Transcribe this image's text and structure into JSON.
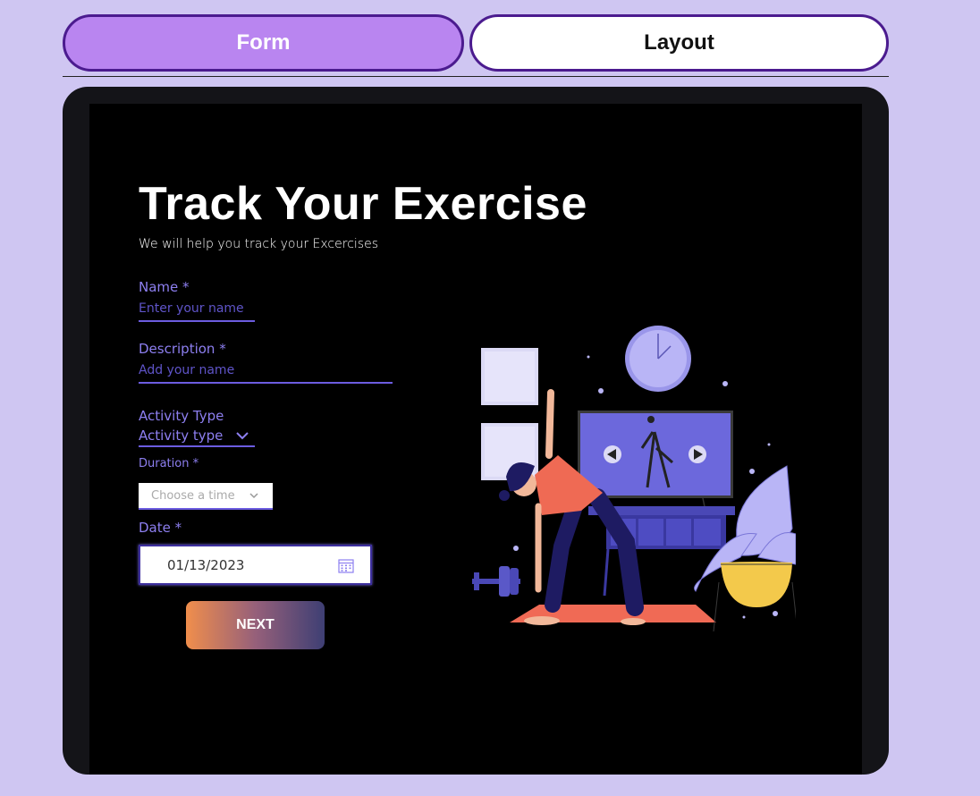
{
  "tabs": {
    "form_label": "Form",
    "layout_label": "Layout"
  },
  "form": {
    "title": "Track Your Exercise",
    "subtitle": "We will help you track your Excercises",
    "name": {
      "label": "Name *",
      "placeholder": "Enter your name",
      "value": ""
    },
    "description": {
      "label": "Description *",
      "placeholder": "Add your name",
      "value": ""
    },
    "activity": {
      "label": "Activity Type",
      "selected": "Activity type"
    },
    "duration": {
      "label": "Duration *",
      "selected": "Choose a time"
    },
    "date": {
      "label": "Date *",
      "value": "01/13/2023"
    },
    "next_label": "NEXT"
  },
  "colors": {
    "background": "#cfc6f2",
    "tab_active": "#b985f0",
    "tab_border": "#4b1b8f",
    "accent_label": "#8d7ff0",
    "button_gradient": [
      "#f08e4c",
      "#3e3f74"
    ]
  },
  "icons": {
    "activity_select": "chevron-down-icon",
    "duration_select": "chevron-down-icon",
    "date_picker": "calendar-icon"
  }
}
